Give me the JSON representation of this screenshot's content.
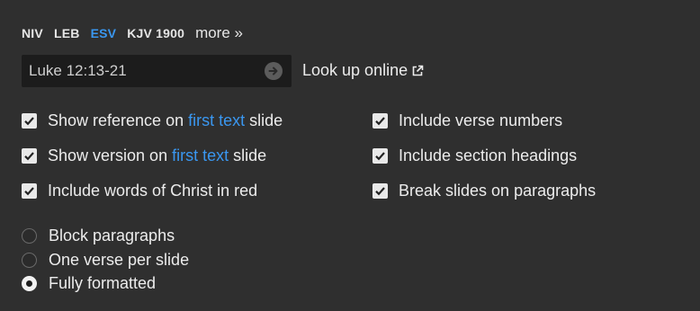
{
  "versions": {
    "items": [
      {
        "label": "NIV",
        "active": false
      },
      {
        "label": "LEB",
        "active": false
      },
      {
        "label": "ESV",
        "active": true
      },
      {
        "label": "KJV 1900",
        "active": false
      }
    ],
    "more_label": "more »"
  },
  "reference": {
    "value": "Luke 12:13-21",
    "go_icon": "arrow-right-circle-icon",
    "lookup_label": "Look up online",
    "lookup_icon": "external-link-icon"
  },
  "options_left": [
    {
      "checked": true,
      "before": "Show reference on",
      "link": "first text",
      "after": "slide"
    },
    {
      "checked": true,
      "before": "Show version on",
      "link": "first text",
      "after": "slide"
    },
    {
      "checked": true,
      "before": "Include words of Christ in red",
      "link": "",
      "after": ""
    }
  ],
  "options_right": [
    {
      "checked": true,
      "label": "Include verse numbers"
    },
    {
      "checked": true,
      "label": "Include section headings"
    },
    {
      "checked": true,
      "label": "Break slides on paragraphs"
    }
  ],
  "format_options": {
    "items": [
      {
        "label": "Block paragraphs",
        "selected": false
      },
      {
        "label": "One verse per slide",
        "selected": false
      },
      {
        "label": "Fully formatted",
        "selected": true
      }
    ]
  },
  "colors": {
    "background": "#2f2f2f",
    "accent": "#3a97f0",
    "input_bg": "#1c1c1c"
  }
}
